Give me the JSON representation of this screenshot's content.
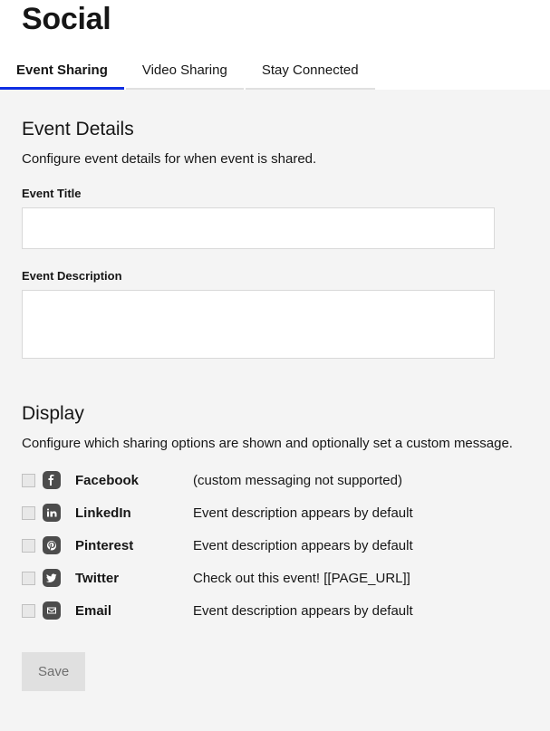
{
  "header": {
    "title": "Social"
  },
  "tabs": [
    {
      "label": "Event Sharing",
      "active": true
    },
    {
      "label": "Video Sharing",
      "active": false
    },
    {
      "label": "Stay Connected",
      "active": false
    }
  ],
  "sections": {
    "event_details": {
      "title": "Event Details",
      "desc": "Configure event details for when event is shared.",
      "fields": {
        "title_label": "Event Title",
        "title_value": "",
        "desc_label": "Event Description",
        "desc_value": ""
      }
    },
    "display": {
      "title": "Display",
      "desc": "Configure which sharing options are shown and optionally set a custom message.",
      "options": [
        {
          "icon": "facebook-icon",
          "name": "Facebook",
          "note": "(custom messaging not supported)"
        },
        {
          "icon": "linkedin-icon",
          "name": "LinkedIn",
          "note": "Event description appears by default"
        },
        {
          "icon": "pinterest-icon",
          "name": "Pinterest",
          "note": "Event description appears by default"
        },
        {
          "icon": "twitter-icon",
          "name": "Twitter",
          "note": "Check out this event! [[PAGE_URL]]"
        },
        {
          "icon": "email-icon",
          "name": "Email",
          "note": "Event description appears by default"
        }
      ]
    }
  },
  "buttons": {
    "save": "Save"
  }
}
